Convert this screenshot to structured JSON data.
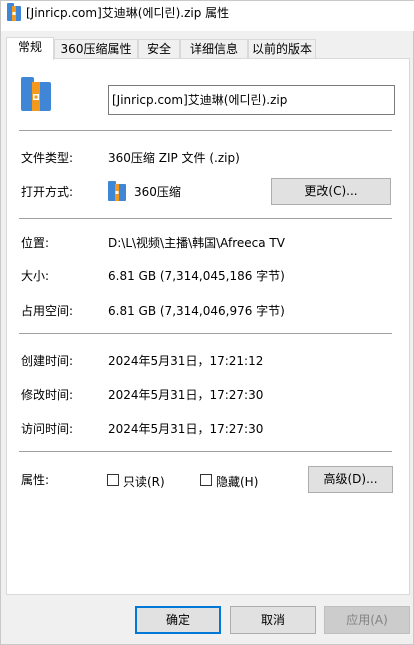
{
  "window": {
    "title": "[Jinricp.com]艾迪琳(에디린).zip 属性"
  },
  "tabs": [
    {
      "label": "常规",
      "active": true
    },
    {
      "label": "360压缩属性",
      "active": false
    },
    {
      "label": "安全",
      "active": false
    },
    {
      "label": "详细信息",
      "active": false
    },
    {
      "label": "以前的版本",
      "active": false
    }
  ],
  "general": {
    "file_name": "[Jinricp.com]艾迪琳(에디린).zip",
    "type_label": "文件类型:",
    "type_value": "360压缩 ZIP 文件 (.zip)",
    "opens_label": "打开方式:",
    "opens_value": "360压缩",
    "change_button": "更改(C)...",
    "location_label": "位置:",
    "location_value": "D:\\L\\视频\\主播\\韩国\\Afreeca TV",
    "size_label": "大小:",
    "size_value": "6.81 GB (7,314,045,186 字节)",
    "size_on_disk_label": "占用空间:",
    "size_on_disk_value": "6.81 GB (7,314,046,976 字节)",
    "created_label": "创建时间:",
    "created_value": "2024年5月31日，17:21:12",
    "modified_label": "修改时间:",
    "modified_value": "2024年5月31日，17:27:30",
    "accessed_label": "访问时间:",
    "accessed_value": "2024年5月31日，17:27:30",
    "attributes_label": "属性:",
    "readonly_label": "只读(R)",
    "readonly_checked": false,
    "hidden_label": "隐藏(H)",
    "hidden_checked": false,
    "advanced_button": "高级(D)..."
  },
  "footer": {
    "ok_button": "确定",
    "cancel_button": "取消",
    "apply_button": "应用(A)",
    "apply_enabled": false
  },
  "icons": {
    "title_icon": "zip-archive-icon",
    "big_icon": "zip-archive-icon",
    "small_icon": "360zip-app-icon"
  },
  "colors": {
    "accent": "#0078d7",
    "archive_blue": "#3f86d6",
    "archive_orange": "#f39a1e"
  }
}
